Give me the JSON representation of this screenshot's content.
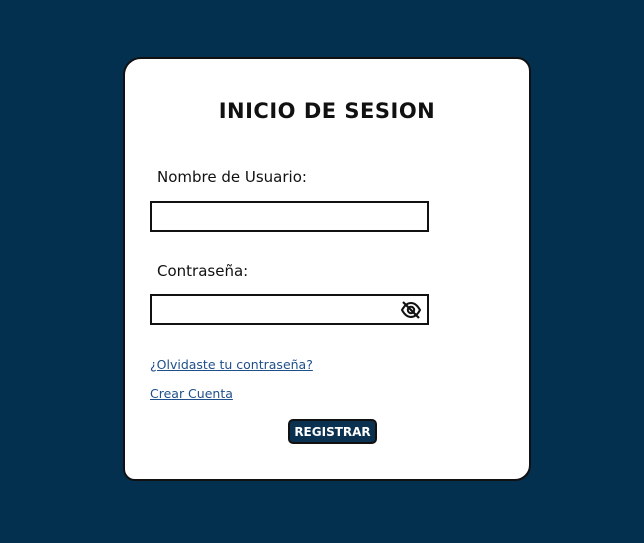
{
  "colors": {
    "background": "#04304f",
    "card": "#ffffff",
    "button": "#0b3150",
    "link": "#1f4f8a"
  },
  "login": {
    "title": "INICIO DE SESION",
    "username_label": "Nombre de Usuario:",
    "username_value": "",
    "password_label": "Contraseña:",
    "password_value": "",
    "password_toggle_icon": "eye-off-icon",
    "forgot_link": "¿Olvidaste tu contraseña?",
    "create_link": "Crear Cuenta",
    "submit_label": "REGISTRAR"
  }
}
